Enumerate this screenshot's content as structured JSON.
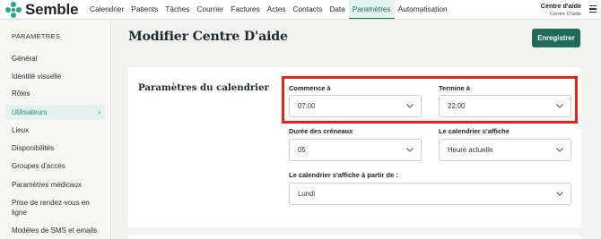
{
  "app": {
    "name": "Semble"
  },
  "nav": [
    "Calendrier",
    "Patients",
    "Tâches",
    "Courrier",
    "Factures",
    "Actes",
    "Contacts",
    "Data",
    "Paramètres",
    "Automatisation"
  ],
  "account": {
    "name": "Centre d'aide",
    "sub": "Centre D'aide"
  },
  "sidebar": {
    "title": "PARAMÈTRES",
    "items": [
      "Général",
      "Identité visuelle",
      "Rôles",
      "Utilisateurs",
      "Lieux",
      "Disponibilités",
      "Groupes d'accès",
      "Paramètres médicaux",
      "Prise de rendez-vous en ligne",
      "Modèles de SMS et emails"
    ],
    "active_chevron": "›"
  },
  "page": {
    "title": "Modifier Centre D'aide",
    "save_label": "Enregistrer"
  },
  "calendar": {
    "section_title": "Paramètres du calendrier",
    "start": {
      "label": "Commence à",
      "value": "07:00"
    },
    "end": {
      "label": "Termine à",
      "value": "22:00"
    },
    "slot": {
      "label": "Durée des créneaux",
      "value": "05"
    },
    "display": {
      "label": "Le calendrier s'affiche",
      "value": "Heure actuelle"
    },
    "display_from": {
      "label": "Le calendrier s'affiche à partir de :",
      "value": "Lundi"
    }
  },
  "colors": {
    "brand": "#1f6b58",
    "highlight": "#e0261b",
    "active_bg": "#e3f2ee"
  }
}
